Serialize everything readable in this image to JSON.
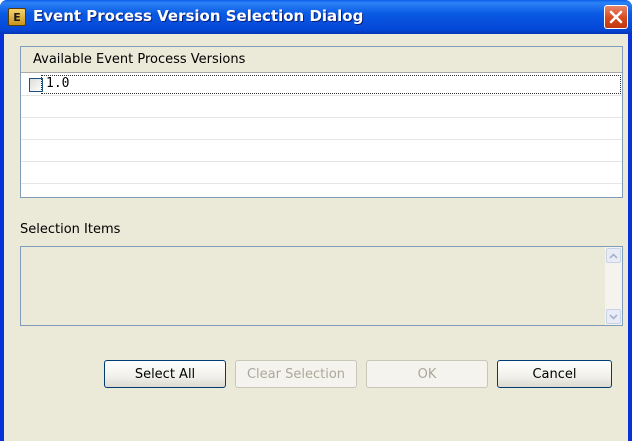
{
  "window": {
    "title": "Event Process Version Selection Dialog",
    "icon_letter": "E"
  },
  "table": {
    "header": "Available Event Process Versions",
    "rows": [
      {
        "label": "1.0",
        "checked": false
      }
    ]
  },
  "selection": {
    "label": "Selection Items",
    "value": ""
  },
  "buttons": {
    "select_all": "Select All",
    "clear_selection": "Clear Selection",
    "ok": "OK",
    "cancel": "Cancel"
  },
  "colors": {
    "titlebar": "#0a5ae4",
    "close": "#d64a1e",
    "panel": "#ebe9d8",
    "border": "#7f9db9"
  }
}
